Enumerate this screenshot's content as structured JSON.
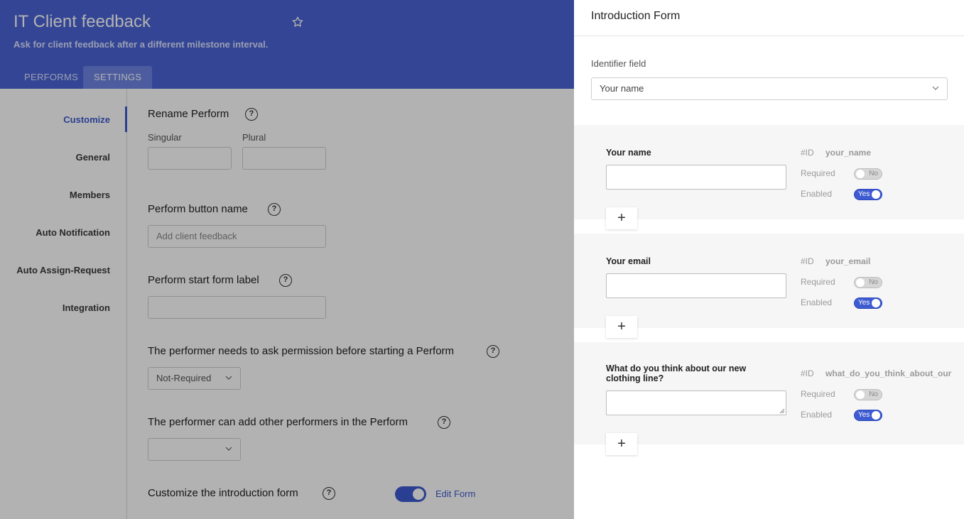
{
  "header": {
    "title": "IT Client feedback",
    "subtitle": "Ask for client feedback after a different milestone interval.",
    "tabs": [
      {
        "label": "PERFORMS",
        "active": false
      },
      {
        "label": "SETTINGS",
        "active": true
      }
    ]
  },
  "sidebar": {
    "items": [
      {
        "label": "Customize",
        "active": true
      },
      {
        "label": "General"
      },
      {
        "label": "Members"
      },
      {
        "label": "Auto Notification"
      },
      {
        "label": "Auto Assign-Request"
      },
      {
        "label": "Integration"
      }
    ]
  },
  "settings": {
    "rename": {
      "label": "Rename Perform",
      "singular_label": "Singular",
      "plural_label": "Plural",
      "singular_value": "",
      "plural_value": ""
    },
    "button_name": {
      "label": "Perform button name",
      "placeholder": "Add client feedback"
    },
    "start_form": {
      "label": "Perform start form label",
      "value": ""
    },
    "permission": {
      "label": "The performer needs to ask permission before starting a Perform",
      "selected": "Not-Required"
    },
    "add_performers": {
      "label": "The performer can add other performers in the Perform",
      "selected": ""
    },
    "intro_form": {
      "label": "Customize the introduction form",
      "toggle_on": true,
      "edit_label": "Edit Form"
    }
  },
  "panel": {
    "title": "Introduction Form",
    "identifier_label": "Identifier field",
    "identifier_value": "Your name",
    "id_prefix": "#ID",
    "required_label": "Required",
    "enabled_label": "Enabled",
    "no_label": "No",
    "yes_label": "Yes",
    "add_symbol": "+",
    "fields": [
      {
        "label": "Your name",
        "id": "your_name",
        "required": false,
        "enabled": true
      },
      {
        "label": "Your email",
        "id": "your_email",
        "required": false,
        "enabled": true
      },
      {
        "label": "What do you think about our new clothing line?",
        "id": "what_do_you_think_about_our",
        "required": false,
        "enabled": true
      }
    ]
  },
  "colors": {
    "header": "#4b64d6",
    "accent": "#3e5bd1",
    "overlay": "rgba(0,0,0,0.30)"
  },
  "icons": [
    "star-icon",
    "help-icon",
    "chevron-down-icon",
    "plus-icon"
  ]
}
